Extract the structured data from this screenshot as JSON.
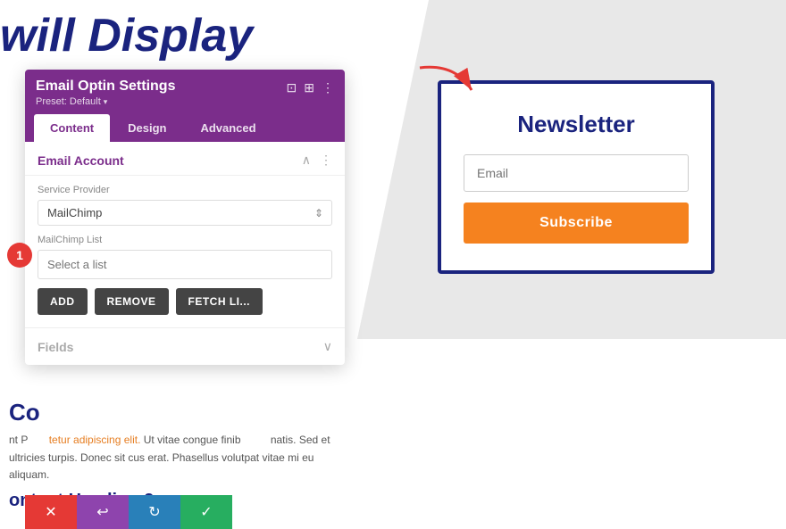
{
  "page": {
    "heading": "will Display",
    "content": {
      "label": "Co",
      "paragraphs": [
        "nt P…     tetur adipiscing elit. Ut vitae congue finib…         natis. Sed et ultricies turpis. Donec sit cus erat. Phasellus volutpat vitae mi eu aliquam."
      ],
      "subheading": "ontent Heading 2"
    }
  },
  "panel": {
    "title": "Email Optin Settings",
    "preset": "Preset: Default",
    "tabs": [
      {
        "label": "Content",
        "active": true
      },
      {
        "label": "Design",
        "active": false
      },
      {
        "label": "Advanced",
        "active": false
      }
    ],
    "header_icons": [
      "⊡",
      "⊞",
      "⋮"
    ],
    "email_account": {
      "section_title": "Email Account",
      "service_provider_label": "Service Provider",
      "service_provider_value": "MailChimp",
      "mailchimp_list_label": "MailChimp List",
      "mailchimp_list_placeholder": "Select a list",
      "buttons": [
        {
          "label": "ADD"
        },
        {
          "label": "REMOVE"
        },
        {
          "label": "FETCH LI..."
        }
      ]
    },
    "fields": {
      "section_title": "Fields"
    }
  },
  "newsletter": {
    "title": "Newsletter",
    "email_placeholder": "Email",
    "subscribe_label": "Subscribe"
  },
  "toolbar": {
    "buttons": [
      {
        "icon": "✕",
        "color": "btn-red",
        "label": "cancel"
      },
      {
        "icon": "↩",
        "color": "btn-purple",
        "label": "undo"
      },
      {
        "icon": "↻",
        "color": "btn-blue",
        "label": "redo"
      },
      {
        "icon": "✓",
        "color": "btn-green",
        "label": "save"
      }
    ]
  },
  "step_badge": "1",
  "icons": {
    "collapse": "∧",
    "expand": "∨",
    "more": "⋮",
    "select_arrow": "⬆"
  },
  "colors": {
    "panel_bg": "#7b2d8b",
    "accent_blue": "#1a237e",
    "orange": "#f5821f"
  }
}
